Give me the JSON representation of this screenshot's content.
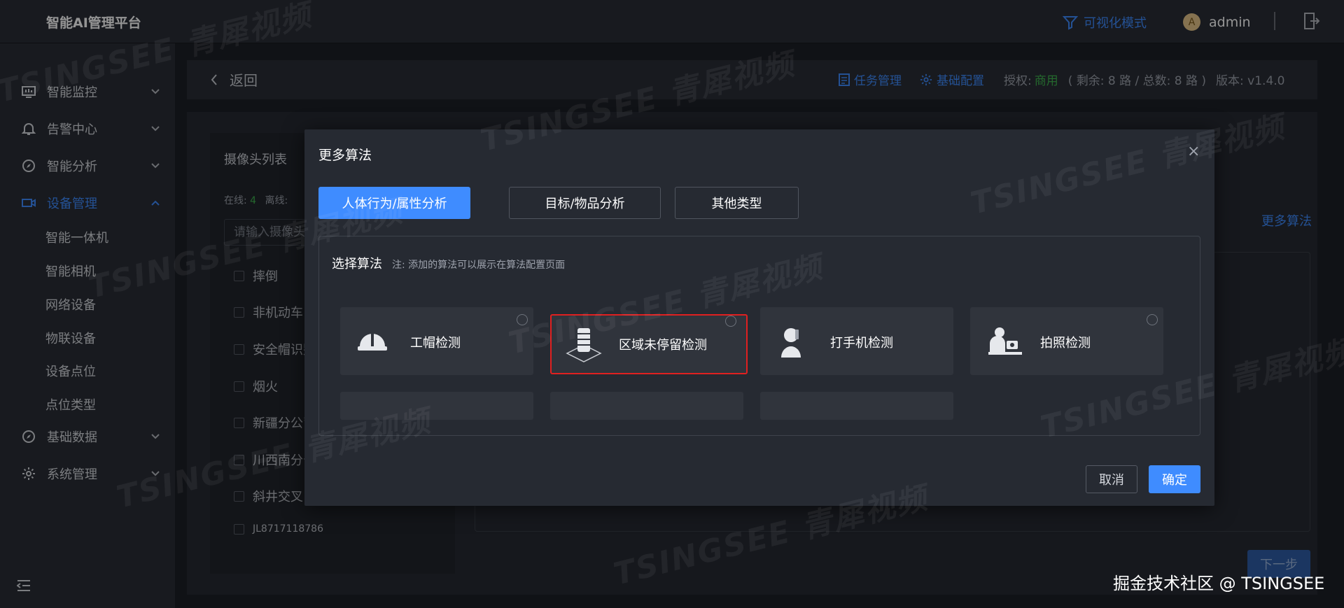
{
  "app": {
    "title": "智能AI管理平台"
  },
  "topbar": {
    "vis_mode": "可视化模式",
    "avatar_letter": "A",
    "user": "admin"
  },
  "sidebar": {
    "items": [
      {
        "label": "智能监控",
        "icon": "monitor-icon"
      },
      {
        "label": "告警中心",
        "icon": "bell-icon"
      },
      {
        "label": "智能分析",
        "icon": "compass-icon"
      },
      {
        "label": "设备管理",
        "icon": "camera-icon",
        "active": true
      },
      {
        "label": "基础数据",
        "icon": "compass-icon"
      },
      {
        "label": "系统管理",
        "icon": "gear-icon"
      }
    ],
    "subitems": [
      "智能一体机",
      "智能相机",
      "网络设备",
      "物联设备",
      "设备点位",
      "点位类型"
    ]
  },
  "header": {
    "back": "返回",
    "task_mgmt": "任务管理",
    "basic_config": "基础配置",
    "auth_label": "授权:",
    "auth_value": "商用",
    "remain_text": "( 剩余: 8 路 / 总数: 8 路 )",
    "version": "版本: v1.4.0"
  },
  "camera_panel": {
    "title": "摄像头列表",
    "online_label": "在线:",
    "online_count": "4",
    "offline_label": "离线:",
    "search_placeholder": "请输入摄像头",
    "items": [
      "摔倒",
      "非机动车",
      "安全帽识别",
      "烟火",
      "新疆分公司",
      "川西南分公",
      "斜井交叉",
      "JL8717118786"
    ]
  },
  "right": {
    "more_algos": "更多算法",
    "next": "下一步"
  },
  "modal": {
    "title": "更多算法",
    "close": "×",
    "tabs": [
      "人体行为/属性分析",
      "目标/物品分析",
      "其他类型"
    ],
    "section_title": "选择算法",
    "note": "注: 添加的算法可以展示在算法配置页面",
    "algorithms": [
      {
        "label": "工帽检测",
        "icon": "helmet-icon"
      },
      {
        "label": "区域未停留检测",
        "icon": "zone-icon",
        "selected": true
      },
      {
        "label": "打手机检测",
        "icon": "phone-call-icon"
      },
      {
        "label": "拍照检测",
        "icon": "photo-icon"
      }
    ],
    "cancel": "取消",
    "confirm": "确定"
  },
  "watermark": "TSINGSEE 青犀视频",
  "footer": {
    "community": "掘金技术社区 @ TSINGSEE"
  }
}
